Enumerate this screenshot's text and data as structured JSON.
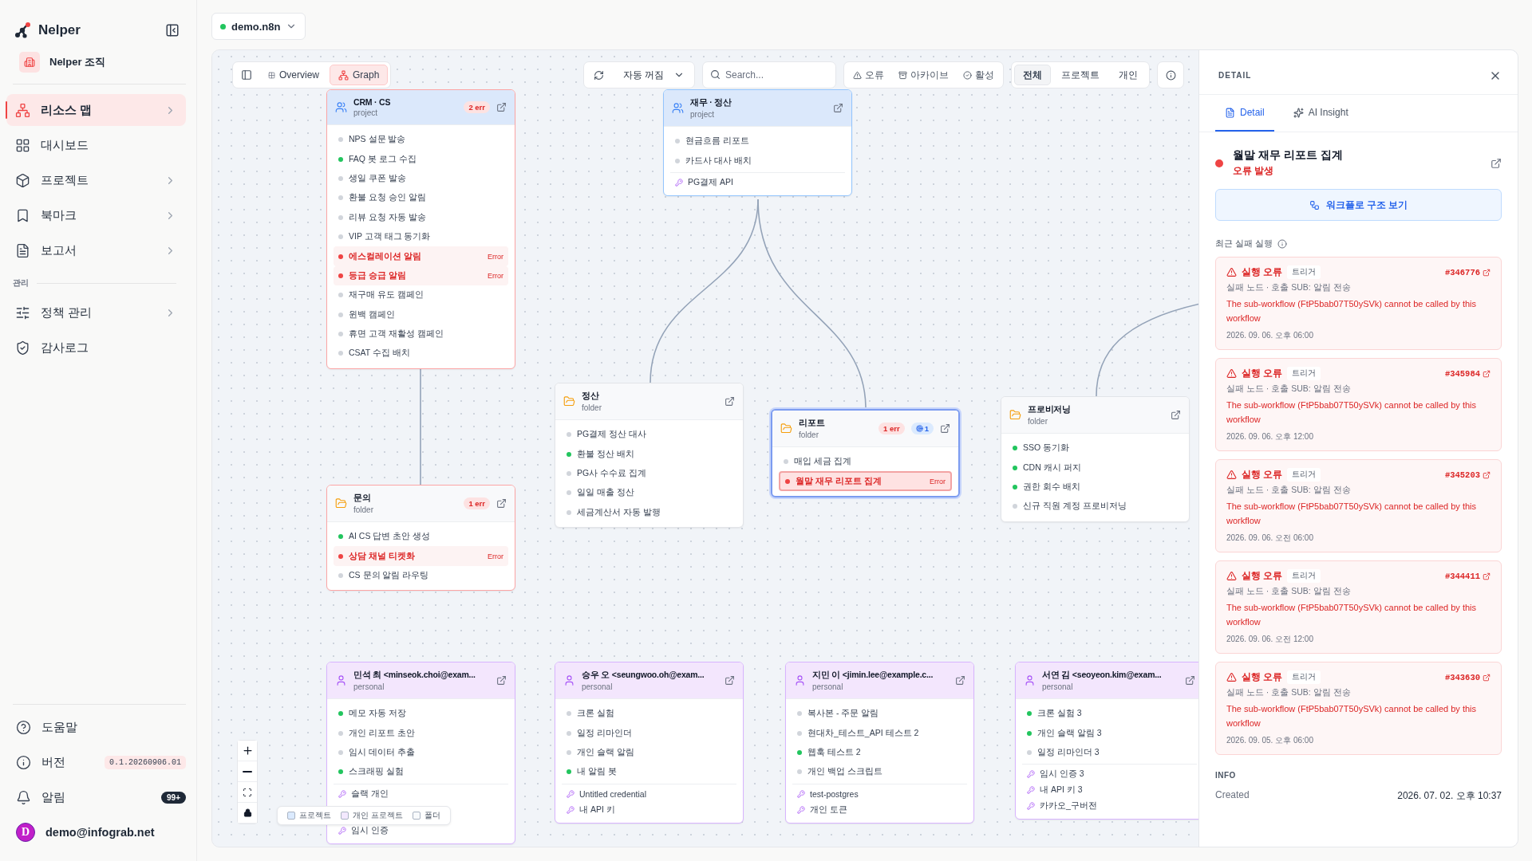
{
  "sidebar": {
    "brand": "Nelper",
    "org": "Nelper 조직",
    "items": [
      {
        "label": "리소스 맵",
        "kind": "map",
        "selected": true,
        "chevron": true
      },
      {
        "label": "대시보드",
        "kind": "dashboard",
        "selected": false,
        "chevron": false
      },
      {
        "label": "프로젝트",
        "kind": "project",
        "selected": false,
        "chevron": true
      },
      {
        "label": "북마크",
        "kind": "bookmark",
        "selected": false,
        "chevron": true
      },
      {
        "label": "보고서",
        "kind": "report",
        "selected": false,
        "chevron": true
      }
    ],
    "section_label": "관리",
    "admin_items": [
      {
        "label": "정책 관리",
        "kind": "policy",
        "selected": false,
        "chevron": true
      },
      {
        "label": "감사로그",
        "kind": "audit",
        "selected": false,
        "chevron": false
      }
    ],
    "footer": [
      {
        "label": "도움말",
        "kind": "help"
      },
      {
        "label": "버전",
        "kind": "version",
        "badge": "0.1.20260906.01"
      },
      {
        "label": "알림",
        "kind": "alerts",
        "badge": "99+"
      }
    ],
    "user": {
      "initial": "D",
      "email": "demo@infograb.net"
    }
  },
  "env": {
    "name": "demo.n8n",
    "connected": true
  },
  "toolbar": {
    "views": [
      {
        "label": "Overview",
        "kind": "overview",
        "selected": false
      },
      {
        "label": "Graph",
        "kind": "graph",
        "selected": true
      }
    ],
    "refresh": {
      "value": "자동 꺼짐"
    },
    "search": {
      "placeholder": "Search..."
    },
    "status_filters": [
      {
        "label": "오류",
        "kind": "error"
      },
      {
        "label": "아카이브",
        "kind": "archive"
      },
      {
        "label": "활성",
        "kind": "active"
      }
    ],
    "scopes": [
      {
        "label": "전체",
        "selected": true
      },
      {
        "label": "프로젝트",
        "selected": false
      },
      {
        "label": "개인",
        "selected": false
      }
    ]
  },
  "nodes": [
    {
      "kind": "project",
      "title": "CRM · CS",
      "subtitle": "project",
      "badges": [
        {
          "kind": "error",
          "text": "2 err"
        }
      ],
      "has_error": true,
      "selected": false,
      "items": [
        {
          "label": "NPS 설문 발송",
          "color": "#d1d5db"
        },
        {
          "label": "FAQ 봇 로그 수집",
          "color": "#22c55e"
        },
        {
          "label": "생일 쿠폰 발송",
          "color": "#d1d5db"
        },
        {
          "label": "환불 요청 승인 알림",
          "color": "#d1d5db"
        },
        {
          "label": "리뷰 요청 자동 발송",
          "color": "#d1d5db"
        },
        {
          "label": "VIP 고객 태그 동기화",
          "color": "#d1d5db"
        },
        {
          "label": "에스컬레이션 알림",
          "color": "#ef4444",
          "error": true,
          "tag": "Error",
          "selected": false
        },
        {
          "label": "등급 승급 알림",
          "color": "#ef4444",
          "error": true,
          "tag": "Error",
          "selected": false
        },
        {
          "label": "재구매 유도 캠페인",
          "color": "#d1d5db"
        },
        {
          "label": "윈백 캠페인",
          "color": "#d1d5db"
        },
        {
          "label": "휴면 고객 재활성 캠페인",
          "color": "#d1d5db"
        },
        {
          "label": "CSAT 수집 배치",
          "color": "#d1d5db"
        }
      ]
    },
    {
      "kind": "project",
      "title": "재무 · 정산",
      "subtitle": "project",
      "has_error": false,
      "selected": false,
      "items": [
        {
          "label": "현금흐름 리포트",
          "color": "#d1d5db"
        },
        {
          "label": "카드사 대사 배치",
          "color": "#d1d5db"
        }
      ],
      "credentials": [
        "PG결제 API"
      ]
    },
    {
      "kind": "folder",
      "title": "정산",
      "subtitle": "folder",
      "has_error": false,
      "selected": false,
      "items": [
        {
          "label": "PG결제 정산 대사",
          "color": "#d1d5db"
        },
        {
          "label": "환불 정산 배치",
          "color": "#22c55e"
        },
        {
          "label": "PG사 수수료 집계",
          "color": "#d1d5db"
        },
        {
          "label": "일일 매출 정산",
          "color": "#d1d5db"
        },
        {
          "label": "세금계산서 자동 발행",
          "color": "#d1d5db"
        }
      ]
    },
    {
      "kind": "folder",
      "title": "리포트",
      "subtitle": "folder",
      "badges": [
        {
          "kind": "error",
          "text": "1 err"
        },
        {
          "kind": "info",
          "text": "1"
        }
      ],
      "has_error": true,
      "selected": true,
      "items": [
        {
          "label": "매입 세금 집계",
          "color": "#d1d5db"
        },
        {
          "label": "월말 재무 리포트 집계",
          "color": "#ef4444",
          "error": true,
          "tag": "Error",
          "selected": true
        }
      ]
    },
    {
      "kind": "folder",
      "title": "프로비저닝",
      "subtitle": "folder",
      "has_error": false,
      "selected": false,
      "items": [
        {
          "label": "SSO 동기화",
          "color": "#22c55e"
        },
        {
          "label": "CDN 캐시 퍼지",
          "color": "#22c55e"
        },
        {
          "label": "권한 회수 배치",
          "color": "#22c55e"
        },
        {
          "label": "신규 직원 계정 프로비저닝",
          "color": "#d1d5db"
        }
      ]
    },
    {
      "kind": "folder",
      "title": "문의",
      "subtitle": "folder",
      "badges": [
        {
          "kind": "error",
          "text": "1 err"
        }
      ],
      "has_error": true,
      "selected": false,
      "items": [
        {
          "label": "AI CS 답변 초안 생성",
          "color": "#22c55e"
        },
        {
          "label": "상담 채널 티켓화",
          "color": "#ef4444",
          "error": true,
          "tag": "Error",
          "selected": false
        },
        {
          "label": "CS 문의 알림 라우팅",
          "color": "#d1d5db"
        }
      ]
    },
    {
      "kind": "personal",
      "title": "민석 최 <minseok.choi@exam...",
      "subtitle": "personal",
      "has_error": false,
      "selected": false,
      "items": [
        {
          "label": "메모 자동 저장",
          "color": "#22c55e"
        },
        {
          "label": "개인 리포트 초안",
          "color": "#d1d5db"
        },
        {
          "label": "임시 데이터 추출",
          "color": "#d1d5db"
        },
        {
          "label": "스크래핑 실험",
          "color": "#22c55e"
        }
      ],
      "credentials": [
        "슬랙 개인",
        "임시 인증"
      ]
    },
    {
      "kind": "personal",
      "title": "승우 오 <seungwoo.oh@exam...",
      "subtitle": "personal",
      "has_error": false,
      "selected": false,
      "items": [
        {
          "label": "크론 실험",
          "color": "#d1d5db"
        },
        {
          "label": "일정 리마인더",
          "color": "#d1d5db"
        },
        {
          "label": "개인 슬랙 알림",
          "color": "#d1d5db"
        },
        {
          "label": "내 알림 봇",
          "color": "#22c55e"
        }
      ],
      "credentials": [
        "Untitled credential",
        "내 API 키"
      ]
    },
    {
      "kind": "personal",
      "title": "지민 이 <jimin.lee@example.c...",
      "subtitle": "personal",
      "has_error": false,
      "selected": false,
      "items": [
        {
          "label": "복사본 - 주문 알림",
          "color": "#d1d5db"
        },
        {
          "label": "현대차_테스트_API 테스트 2",
          "color": "#d1d5db"
        },
        {
          "label": "웹훅 테스트 2",
          "color": "#22c55e"
        },
        {
          "label": "개인 백업 스크립트",
          "color": "#d1d5db"
        }
      ],
      "credentials": [
        "test-postgres",
        "개인 토큰"
      ]
    },
    {
      "kind": "personal",
      "title": "서연 김 <seoyeon.kim@exam...",
      "subtitle": "personal",
      "has_error": false,
      "selected": false,
      "items": [
        {
          "label": "크론 실험 3",
          "color": "#22c55e"
        },
        {
          "label": "개인 슬랙 알림 3",
          "color": "#22c55e"
        },
        {
          "label": "일정 리마인더 3",
          "color": "#d1d5db"
        }
      ],
      "credentials": [
        "임시 인증 3",
        "내 API 키 3",
        "카카오_구버전"
      ]
    }
  ],
  "legend": [
    {
      "label": "프로젝트",
      "color": "#dbeafe"
    },
    {
      "label": "개인 프로젝트",
      "color": "#f3e8ff"
    },
    {
      "label": "폴더",
      "color": "#f8fafc"
    }
  ],
  "detail": {
    "heading": "DETAIL",
    "tabs": [
      {
        "label": "Detail",
        "kind": "detail",
        "selected": true
      },
      {
        "label": "AI Insight",
        "kind": "insight",
        "selected": false
      }
    ],
    "title": "월말 재무 리포트 집계",
    "status": "오류 발생",
    "error": true,
    "action": "워크플로 구조 보기",
    "runs_label": "최근 실패 실행",
    "runs": [
      {
        "title": "실행 오류",
        "tag": "트리거",
        "id": "#346776",
        "node": "실패 노드 · 호출 SUB: 알림 전송",
        "message": "The sub-workflow (FtP5bab07T50ySVk) cannot be called by this workflow",
        "time": "2026. 09. 06. 오후 06:00"
      },
      {
        "title": "실행 오류",
        "tag": "트리거",
        "id": "#345984",
        "node": "실패 노드 · 호출 SUB: 알림 전송",
        "message": "The sub-workflow (FtP5bab07T50ySVk) cannot be called by this workflow",
        "time": "2026. 09. 06. 오후 12:00"
      },
      {
        "title": "실행 오류",
        "tag": "트리거",
        "id": "#345203",
        "node": "실패 노드 · 호출 SUB: 알림 전송",
        "message": "The sub-workflow (FtP5bab07T50ySVk) cannot be called by this workflow",
        "time": "2026. 09. 06. 오전 06:00"
      },
      {
        "title": "실행 오류",
        "tag": "트리거",
        "id": "#344411",
        "node": "실패 노드 · 호출 SUB: 알림 전송",
        "message": "The sub-workflow (FtP5bab07T50ySVk) cannot be called by this workflow",
        "time": "2026. 09. 06. 오전 12:00"
      },
      {
        "title": "실행 오류",
        "tag": "트리거",
        "id": "#343630",
        "node": "실패 노드 · 호출 SUB: 알림 전송",
        "message": "The sub-workflow (FtP5bab07T50ySVk) cannot be called by this workflow",
        "time": "2026. 09. 05. 오후 06:00"
      }
    ],
    "info_label": "INFO",
    "info": [
      {
        "label": "Created",
        "value": "2026. 07. 02. 오후 10:37"
      }
    ]
  }
}
